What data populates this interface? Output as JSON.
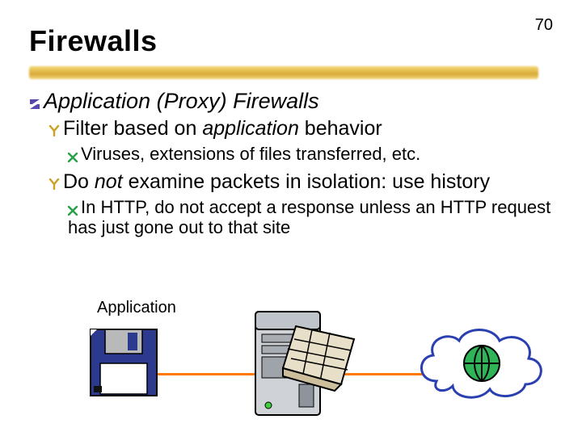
{
  "page_number": "70",
  "title": "Firewalls",
  "bullets": {
    "l1_text": "Application (Proxy) Firewalls",
    "l2a_prefix": "Filter based on ",
    "l2a_italic": "application",
    "l2a_suffix": " behavior",
    "l3a": "Viruses, extensions of files transferred, etc.",
    "l2b_prefix": "Do ",
    "l2b_italic": "not",
    "l2b_suffix": " examine packets in isolation: use history",
    "l3b": "In HTTP, do not accept a response unless an HTTP request has just gone out to that site"
  },
  "diagram": {
    "application_label": "Application"
  },
  "colors": {
    "accent_underline": "#e4bb4a",
    "arrow": "#ff7a00",
    "z_bullet": "#5b47b0",
    "y_bullet": "#e4c24a",
    "x_bullet": "#2aa04a"
  }
}
